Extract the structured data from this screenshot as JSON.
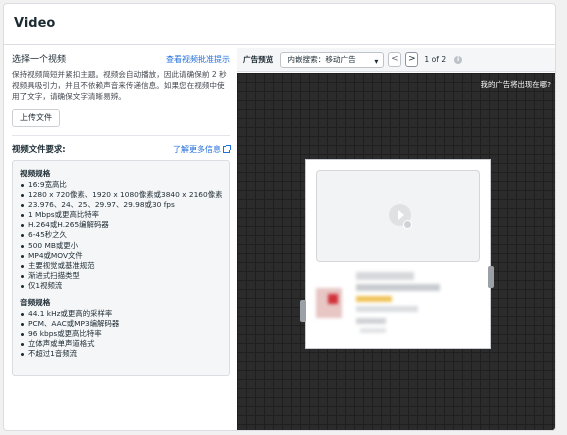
{
  "header": {
    "title": "Video"
  },
  "upload": {
    "heading": "选择一个视频",
    "link": "查看视频批准提示",
    "description": "保持视频简短并紧扣主题。视频会自动播放，因此请确保前 2 秒视频具吸引力，并且不依赖声音来传递信息。如果您在视频中使用了文字，请确保文字清晰易辨。",
    "button": "上传文件"
  },
  "requirements": {
    "heading": "视频文件要求:",
    "link": "了解更多信息",
    "video_specs": {
      "heading": "视频规格",
      "items": [
        "16:9宽高比",
        "1280 x 720像素、1920 x 1080像素或3840 x 2160像素",
        "23.976、24、25、29.97、29.98或30 fps",
        "1 Mbps或更高比特率",
        "H.264或H.265编解码器",
        "6-45秒之久",
        "500 MB或更小",
        "MP4或MOV文件",
        "主要视觉或基准规范",
        "渐进式扫描类型",
        "仅1视频流"
      ]
    },
    "audio_specs": {
      "heading": "音频规格",
      "items": [
        "44.1 kHz或更高的采样率",
        "PCM、AAC或MP3编解码器",
        "96 kbps或更高比特率",
        "立体声或单声道格式",
        "不超过1音频流"
      ]
    }
  },
  "preview": {
    "label": "广告预览",
    "placement": "内嵌搜索：移动广告",
    "prev": "<",
    "next": ">",
    "pager": "1 of 2",
    "info": "i",
    "why_link": "我的广告将出现在哪?"
  }
}
